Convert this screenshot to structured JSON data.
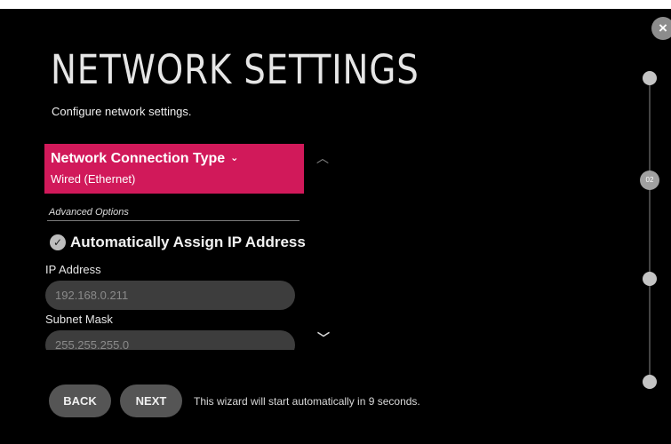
{
  "window": {
    "close_glyph": "×"
  },
  "header": {
    "title": "NETWORK SETTINGS",
    "subtitle": "Configure network settings."
  },
  "connection": {
    "label": "Network Connection Type",
    "chevron": "⌄",
    "value": "Wired (Ethernet)",
    "accent_color": "#d1195a"
  },
  "advanced": {
    "label": "Advanced Options",
    "auto_assign_label": "Automatically Assign IP Address",
    "auto_assign_checked": true,
    "check_glyph": "✓",
    "fields": [
      {
        "label": "IP Address",
        "value": "192.168.0.211"
      },
      {
        "label": "Subnet Mask",
        "value": "255.255.255.0"
      }
    ]
  },
  "scroll": {
    "up_glyph": "︿",
    "down_glyph": "﹀"
  },
  "footer": {
    "back_label": "BACK",
    "next_label": "NEXT",
    "wizard_message": "This wizard will start automatically in 9 seconds."
  },
  "progress": {
    "current_step_label": "02",
    "current_step": 2,
    "total_steps": 5
  },
  "icons": [
    "close-icon",
    "chevron-down-icon",
    "check-icon",
    "scroll-up-icon",
    "scroll-down-icon"
  ]
}
